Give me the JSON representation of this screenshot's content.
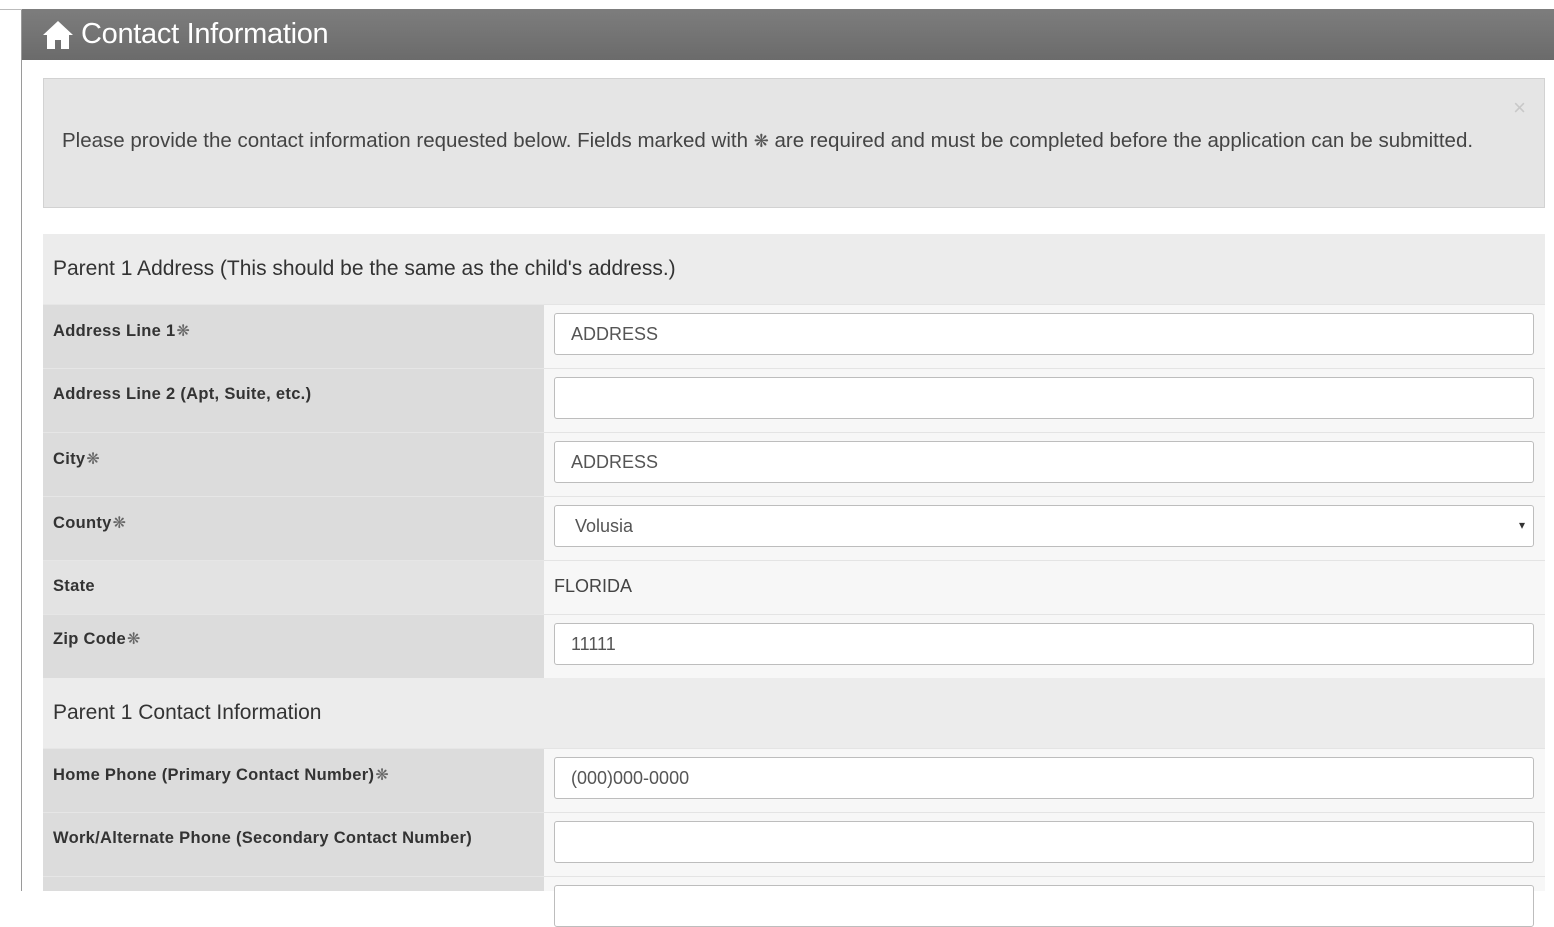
{
  "header": {
    "title": "Contact Information",
    "icon": "home-icon"
  },
  "alert": {
    "text_before": "Please provide the contact information requested below. Fields marked with",
    "required_symbol": "❋",
    "text_after": "are required and must be completed before the application can be submitted.",
    "close_label": "×"
  },
  "sections": {
    "address": {
      "title": "Parent 1 Address (This should be the same as the child's address.)"
    },
    "contact": {
      "title": "Parent 1 Contact Information"
    }
  },
  "fields": {
    "address1": {
      "label": "Address Line 1",
      "required": "❋",
      "value": "ADDRESS"
    },
    "address2": {
      "label": "Address Line 2 (Apt, Suite, etc.)",
      "value": ""
    },
    "city": {
      "label": "City",
      "required": "❋",
      "value": "ADDRESS"
    },
    "county": {
      "label": "County",
      "required": "❋",
      "selected": "Volusia",
      "caret": "▾"
    },
    "state": {
      "label": "State",
      "value": "FLORIDA"
    },
    "zip": {
      "label": "Zip Code",
      "required": "❋",
      "value": "11111"
    },
    "home_phone": {
      "label": "Home Phone (Primary Contact Number)",
      "required": "❋",
      "placeholder": "(000)000-0000"
    },
    "work_phone": {
      "label": "Work/Alternate Phone (Secondary Contact Number)",
      "value": ""
    }
  }
}
